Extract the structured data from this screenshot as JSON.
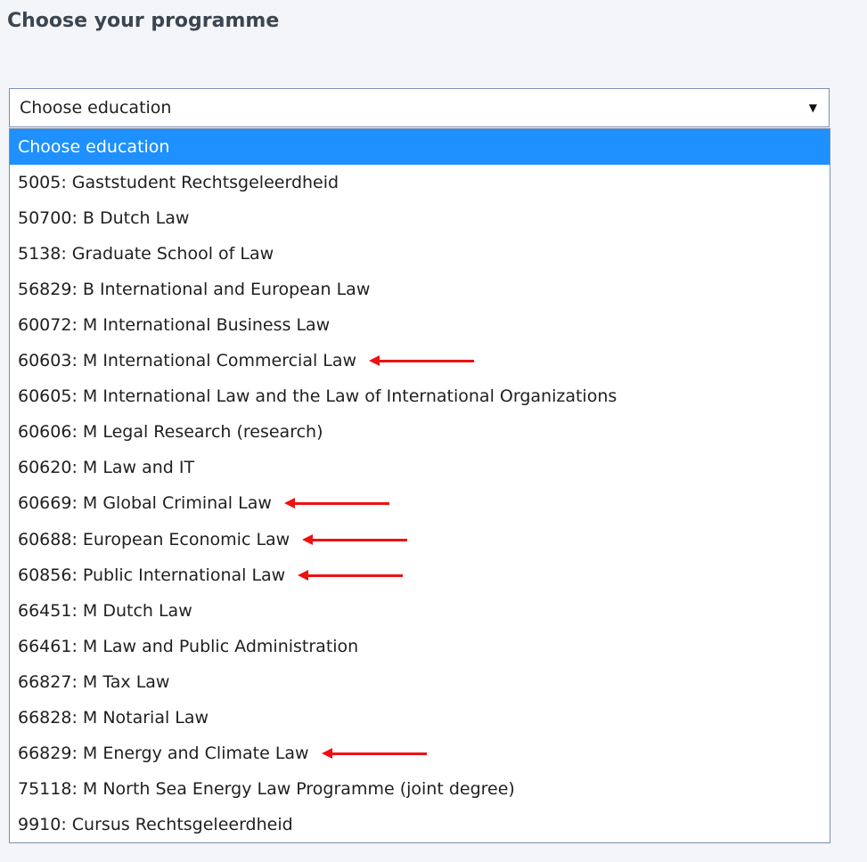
{
  "heading": "Choose your programme",
  "select": {
    "value": "Choose education",
    "caret": "▼"
  },
  "options": [
    {
      "label": "Choose education",
      "selected": true,
      "arrow": false
    },
    {
      "label": "5005: Gaststudent Rechtsgeleerdheid",
      "selected": false,
      "arrow": false
    },
    {
      "label": "50700: B Dutch Law",
      "selected": false,
      "arrow": false
    },
    {
      "label": "5138: Graduate School of Law",
      "selected": false,
      "arrow": false
    },
    {
      "label": "56829: B International and European Law",
      "selected": false,
      "arrow": false
    },
    {
      "label": "60072: M International Business Law",
      "selected": false,
      "arrow": false
    },
    {
      "label": "60603: M International Commercial Law",
      "selected": false,
      "arrow": true
    },
    {
      "label": "60605: M International Law and the Law of International Organizations",
      "selected": false,
      "arrow": false
    },
    {
      "label": "60606: M Legal Research (research)",
      "selected": false,
      "arrow": false
    },
    {
      "label": "60620: M Law and IT",
      "selected": false,
      "arrow": false
    },
    {
      "label": "60669: M Global Criminal Law",
      "selected": false,
      "arrow": true
    },
    {
      "label": "60688: European Economic Law",
      "selected": false,
      "arrow": true
    },
    {
      "label": "60856: Public International Law",
      "selected": false,
      "arrow": true
    },
    {
      "label": "66451: M Dutch Law",
      "selected": false,
      "arrow": false
    },
    {
      "label": "66461: M Law and Public Administration",
      "selected": false,
      "arrow": false
    },
    {
      "label": "66827: M Tax Law",
      "selected": false,
      "arrow": false
    },
    {
      "label": "66828: M Notarial Law",
      "selected": false,
      "arrow": false
    },
    {
      "label": "66829: M Energy and Climate Law",
      "selected": false,
      "arrow": true
    },
    {
      "label": "75118: M North Sea Energy Law Programme (joint degree)",
      "selected": false,
      "arrow": false
    },
    {
      "label": "9910: Cursus Rechtsgeleerdheid",
      "selected": false,
      "arrow": false
    }
  ],
  "colors": {
    "highlight": "#1e90ff",
    "annotation_arrow": "#ee1111"
  }
}
